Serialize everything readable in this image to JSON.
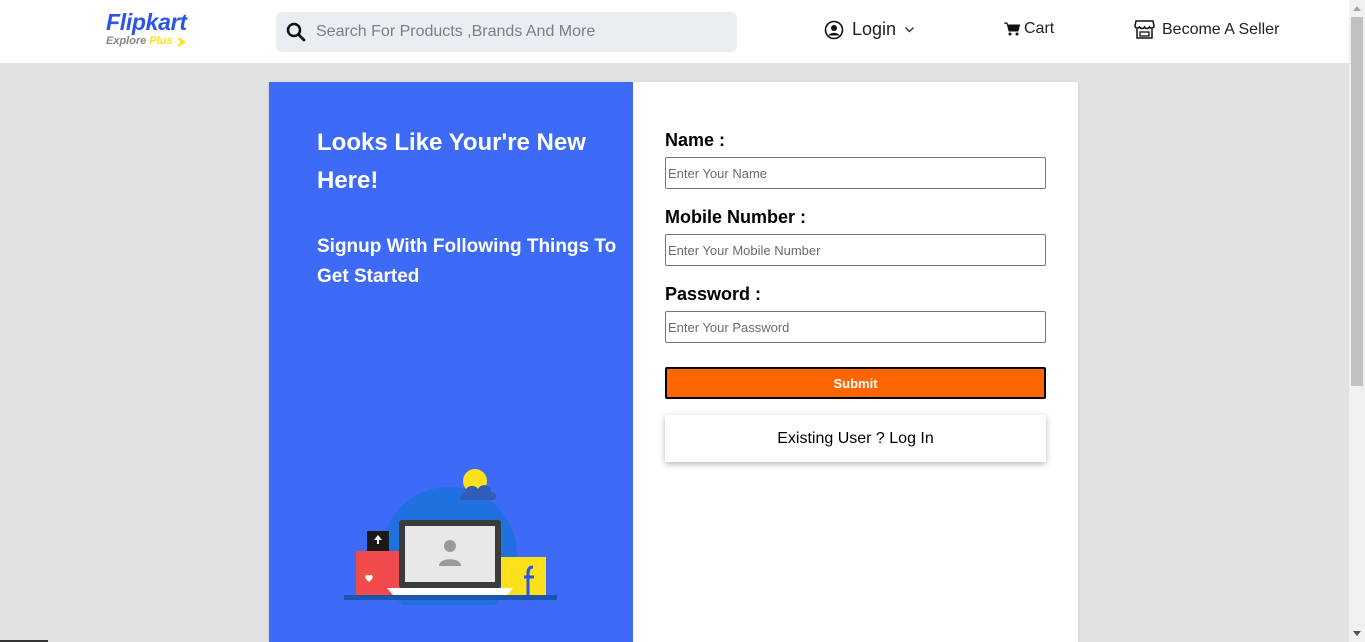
{
  "header": {
    "logo_main": "Flipkart",
    "logo_sub_explore": "Explore",
    "logo_sub_plus": "Plus",
    "search_placeholder": "Search For Products ,Brands And More",
    "login_label": "Login",
    "cart_label": "Cart",
    "seller_label": "Become A Seller"
  },
  "left_panel": {
    "title": "Looks Like Your're New Here!",
    "subtitle": "Signup With Following Things To Get Started"
  },
  "form": {
    "name_label": "Name :",
    "name_placeholder": "Enter Your Name",
    "mobile_label": "Mobile Number :",
    "mobile_placeholder": "Enter Your Mobile Number",
    "password_label": "Password :",
    "password_placeholder": "Enter Your Password",
    "submit_label": "Submit",
    "existing_label": "Existing User ? Log In"
  },
  "colors": {
    "brand_blue": "#2a55e5",
    "panel_blue": "#3d6af7",
    "submit_orange": "#ff6600",
    "plus_yellow": "#ffe11b"
  },
  "icons": [
    "search-icon",
    "user-icon",
    "chevron-down-icon",
    "cart-icon",
    "store-icon"
  ]
}
